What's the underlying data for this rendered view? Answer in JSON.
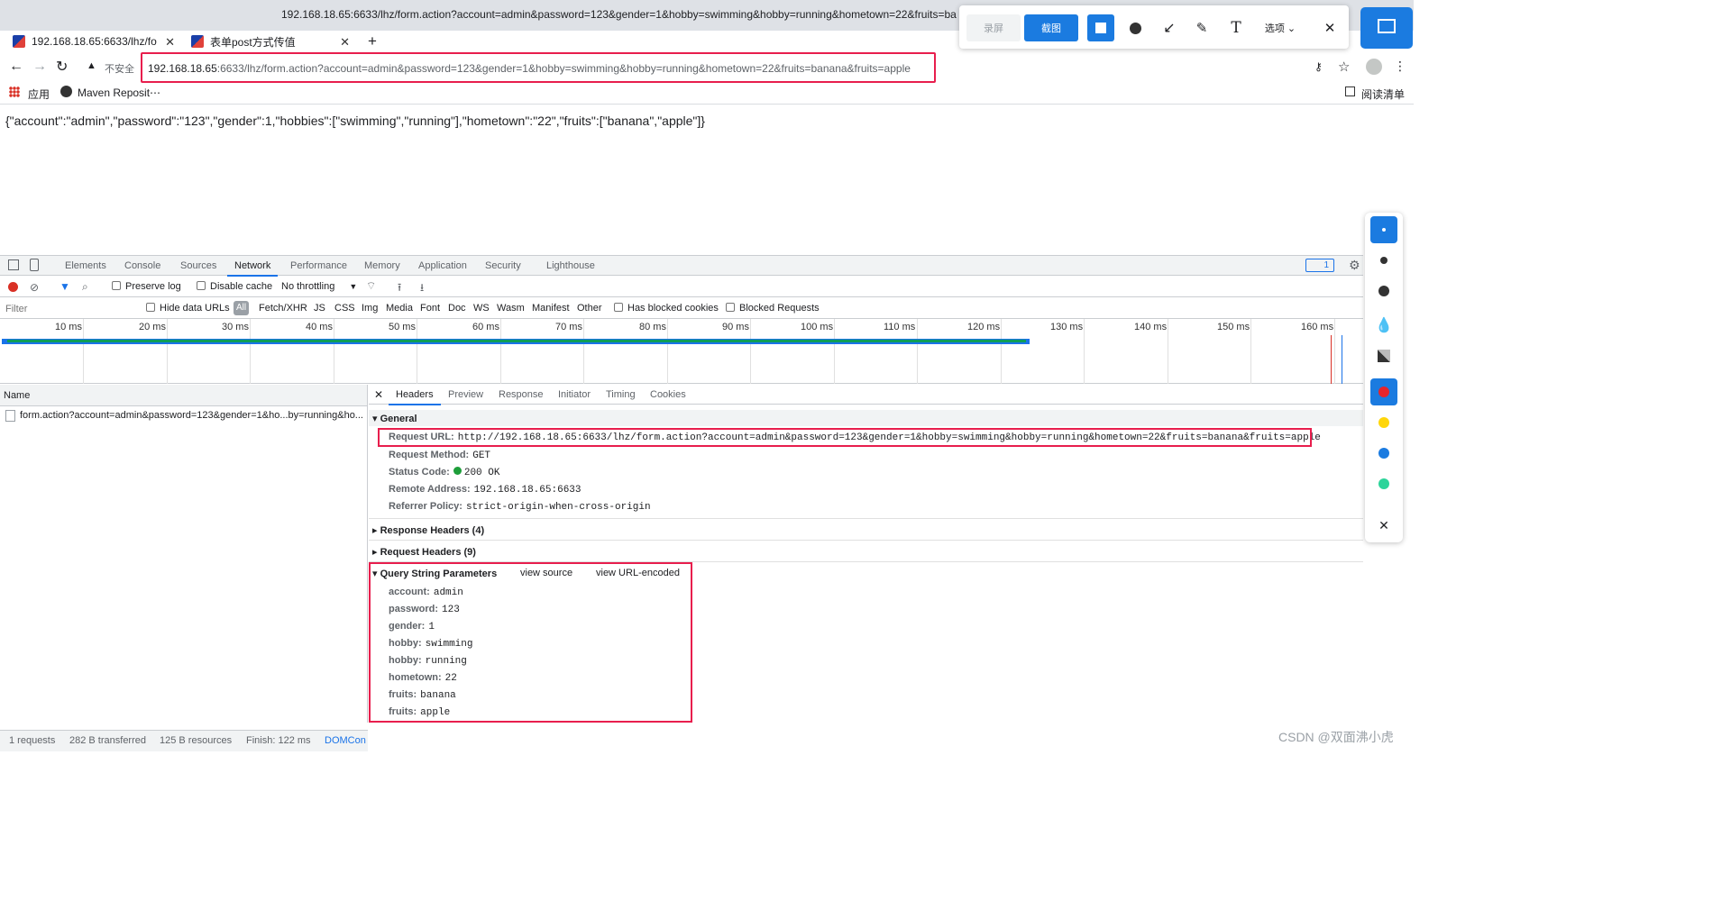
{
  "window": {
    "title": "192.168.18.65:6633/lhz/form.action?account=admin&password=123&gender=1&hobby=swimming&hobby=running&hometown=22&fruits=ba"
  },
  "tabs": [
    {
      "label": "192.168.18.65:6633/lhz/fo",
      "active": true
    },
    {
      "label": "表单post方式传值",
      "active": false
    }
  ],
  "omnibox": {
    "security": "不安全",
    "host": "192.168.18.65",
    "rest": ":6633/lhz/form.action?account=admin&password=123&gender=1&hobby=swimming&hobby=running&hometown=22&fruits=banana&fruits=apple"
  },
  "bookmarks": {
    "apps": "应用",
    "maven": "Maven Reposit⋯",
    "reading_list": "阅读清单"
  },
  "screenshot_tool": {
    "record": "录屏",
    "capture": "截图",
    "options": "选项"
  },
  "page": {
    "json_text": "{\"account\":\"admin\",\"password\":\"123\",\"gender\":1,\"hobbies\":[\"swimming\",\"running\"],\"hometown\":\"22\",\"fruits\":[\"banana\",\"apple\"]}"
  },
  "devtools": {
    "tabs": [
      "Elements",
      "Console",
      "Sources",
      "Network",
      "Performance",
      "Memory",
      "Application",
      "Security",
      "Lighthouse"
    ],
    "issues_badge": "1",
    "preserve_log": "Preserve log",
    "disable_cache": "Disable cache",
    "throttling": "No throttling",
    "filter_placeholder": "Filter",
    "hide_data_urls": "Hide data URLs",
    "filter_types": [
      "All",
      "Fetch/XHR",
      "JS",
      "CSS",
      "Img",
      "Media",
      "Font",
      "Doc",
      "WS",
      "Wasm",
      "Manifest",
      "Other"
    ],
    "has_blocked_cookies": "Has blocked cookies",
    "blocked_requests": "Blocked Requests",
    "ticks": [
      "10 ms",
      "20 ms",
      "30 ms",
      "40 ms",
      "50 ms",
      "60 ms",
      "70 ms",
      "80 ms",
      "90 ms",
      "100 ms",
      "110 ms",
      "120 ms",
      "130 ms",
      "140 ms",
      "150 ms",
      "160 ms"
    ],
    "name_header": "Name",
    "request_name": "form.action?account=admin&password=123&gender=1&ho...by=running&ho...",
    "detail_tabs": [
      "Headers",
      "Preview",
      "Response",
      "Initiator",
      "Timing",
      "Cookies"
    ],
    "general": {
      "title": "General",
      "request_url_k": "Request URL:",
      "request_url_v": "http://192.168.18.65:6633/lhz/form.action?account=admin&password=123&gender=1&hobby=swimming&hobby=running&hometown=22&fruits=banana&fruits=apple",
      "method_k": "Request Method:",
      "method_v": "GET",
      "status_k": "Status Code:",
      "status_v": "200 OK",
      "remote_k": "Remote Address:",
      "remote_v": "192.168.18.65:6633",
      "referrer_k": "Referrer Policy:",
      "referrer_v": "strict-origin-when-cross-origin"
    },
    "response_headers": "Response Headers (4)",
    "request_headers": "Request Headers (9)",
    "query": {
      "title": "Query String Parameters",
      "view_source": "view source",
      "view_encoded": "view URL-encoded",
      "params": [
        {
          "k": "account:",
          "v": "admin"
        },
        {
          "k": "password:",
          "v": "123"
        },
        {
          "k": "gender:",
          "v": "1"
        },
        {
          "k": "hobby:",
          "v": "swimming"
        },
        {
          "k": "hobby:",
          "v": "running"
        },
        {
          "k": "hometown:",
          "v": "22"
        },
        {
          "k": "fruits:",
          "v": "banana"
        },
        {
          "k": "fruits:",
          "v": "apple"
        }
      ]
    },
    "status_bar": {
      "requests": "1 requests",
      "transferred": "282 B transferred",
      "resources": "125 B resources",
      "finish": "Finish: 122 ms",
      "domcontent": "DOMCon"
    }
  },
  "watermark": "CSDN @双面沸小虎"
}
